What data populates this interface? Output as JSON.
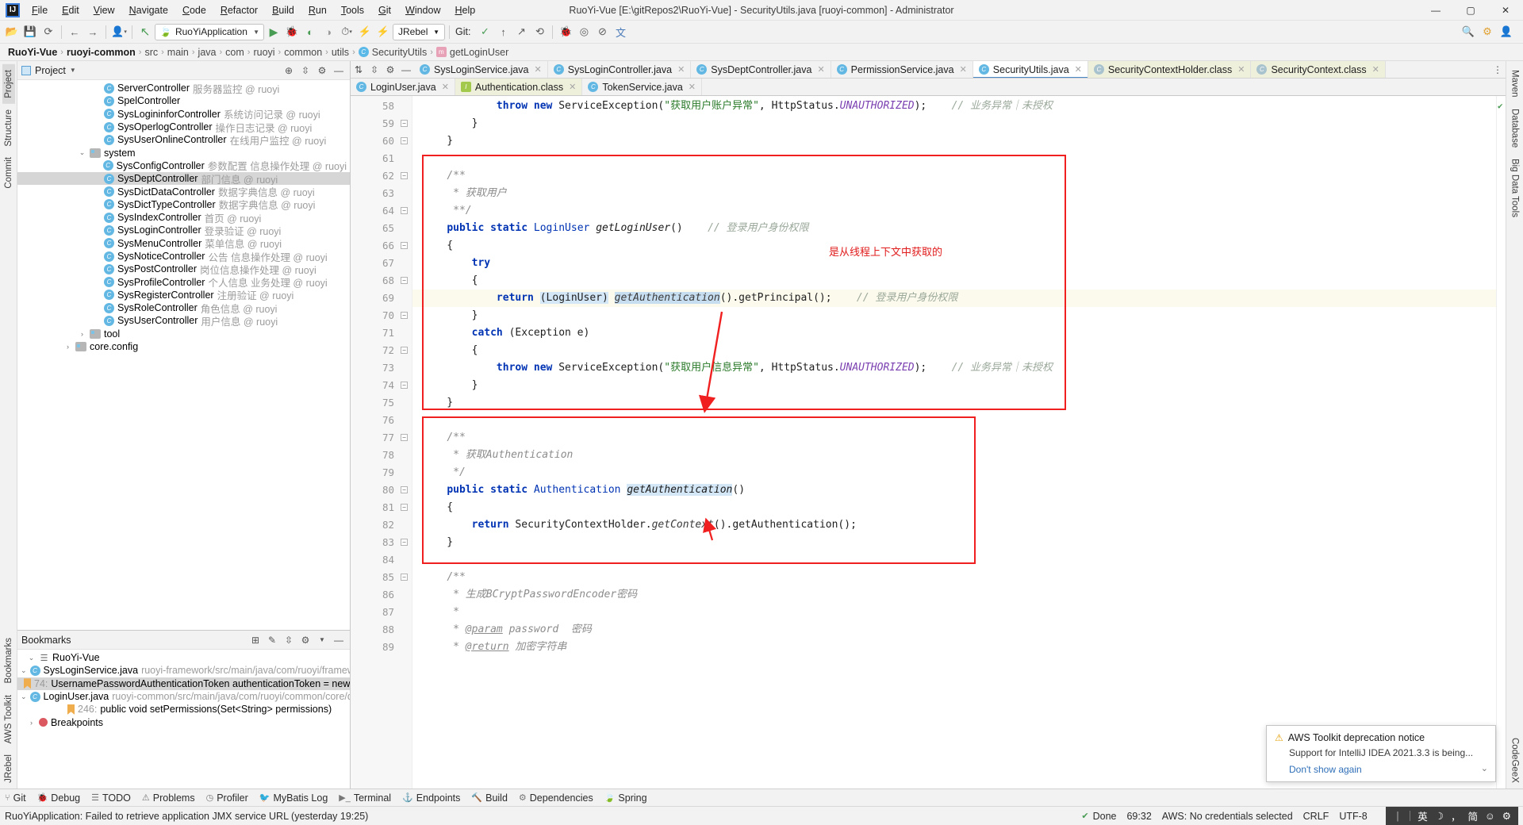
{
  "window": {
    "title": "RuoYi-Vue [E:\\gitRepos2\\RuoYi-Vue] - SecurityUtils.java [ruoyi-common] - Administrator",
    "minimize": "—",
    "maximize": "▢",
    "close": "✕"
  },
  "menu": [
    "File",
    "Edit",
    "View",
    "Navigate",
    "Code",
    "Refactor",
    "Build",
    "Run",
    "Tools",
    "Git",
    "Window",
    "Help"
  ],
  "toolbar": {
    "run_config": "RuoYiApplication",
    "jrebel": "JRebel",
    "git_label": "Git:",
    "icons": [
      "open-folder-icon",
      "save-icon",
      "sync-icon",
      "back-arrow-icon",
      "forward-arrow-icon",
      "user-icon",
      "update-project-icon"
    ],
    "run_icons": [
      "run-icon",
      "debug-icon",
      "run-coverage-icon",
      "profile-icon",
      "run-with-history-icon",
      "jrebel-run-icon",
      "jrebel-debug-icon"
    ],
    "git_icons": [
      "git-update-icon",
      "git-commit-icon",
      "git-push-icon",
      "git-history-icon",
      "git-rollback-icon"
    ],
    "right_icons": [
      "search-everywhere-icon",
      "settings-gear-icon",
      "account-icon"
    ]
  },
  "breadcrumb": [
    {
      "label": "RuoYi-Vue",
      "bold": true
    },
    {
      "label": "ruoyi-common",
      "bold": true
    },
    {
      "label": "src"
    },
    {
      "label": "main"
    },
    {
      "label": "java"
    },
    {
      "label": "com"
    },
    {
      "label": "ruoyi"
    },
    {
      "label": "common"
    },
    {
      "label": "utils"
    },
    {
      "label": "SecurityUtils",
      "icon": "class-icon"
    },
    {
      "label": "getLoginUser",
      "icon": "method-icon"
    }
  ],
  "left_rail": [
    "Project",
    "Structure",
    "Commit",
    "Bookmarks",
    "AWS Toolkit",
    "JRebel"
  ],
  "right_rail": [
    "Maven",
    "Database",
    "Big Data Tools",
    "CodeGeeX"
  ],
  "project_panel": {
    "title": "Project",
    "actions": [
      "target-icon",
      "collapse-all-icon",
      "settings-icon",
      "hide-icon"
    ],
    "tree": [
      {
        "indent": 5,
        "icon": "class",
        "name": "ServerController",
        "desc": "服务器监控 @ ruoyi"
      },
      {
        "indent": 5,
        "icon": "class",
        "name": "SpelController",
        "desc": ""
      },
      {
        "indent": 5,
        "icon": "class",
        "name": "SysLogininforController",
        "desc": "系统访问记录 @ ruoyi"
      },
      {
        "indent": 5,
        "icon": "class",
        "name": "SysOperlogController",
        "desc": "操作日志记录 @ ruoyi"
      },
      {
        "indent": 5,
        "icon": "class",
        "name": "SysUserOnlineController",
        "desc": "在线用户监控 @ ruoyi"
      },
      {
        "indent": 4,
        "icon": "folder",
        "arrow": "v",
        "name": "system",
        "desc": ""
      },
      {
        "indent": 5,
        "icon": "class",
        "name": "SysConfigController",
        "desc": "参数配置 信息操作处理 @ ruoyi"
      },
      {
        "indent": 5,
        "icon": "class",
        "name": "SysDeptController",
        "desc": "部门信息 @ ruoyi",
        "selected": true
      },
      {
        "indent": 5,
        "icon": "class",
        "name": "SysDictDataController",
        "desc": "数据字典信息 @ ruoyi"
      },
      {
        "indent": 5,
        "icon": "class",
        "name": "SysDictTypeController",
        "desc": "数据字典信息 @ ruoyi"
      },
      {
        "indent": 5,
        "icon": "class",
        "name": "SysIndexController",
        "desc": "首页 @ ruoyi"
      },
      {
        "indent": 5,
        "icon": "class",
        "name": "SysLoginController",
        "desc": "登录验证 @ ruoyi"
      },
      {
        "indent": 5,
        "icon": "class",
        "name": "SysMenuController",
        "desc": "菜单信息 @ ruoyi"
      },
      {
        "indent": 5,
        "icon": "class",
        "name": "SysNoticeController",
        "desc": "公告 信息操作处理 @ ruoyi"
      },
      {
        "indent": 5,
        "icon": "class",
        "name": "SysPostController",
        "desc": "岗位信息操作处理 @ ruoyi"
      },
      {
        "indent": 5,
        "icon": "class",
        "name": "SysProfileController",
        "desc": "个人信息 业务处理 @ ruoyi"
      },
      {
        "indent": 5,
        "icon": "class",
        "name": "SysRegisterController",
        "desc": "注册验证 @ ruoyi"
      },
      {
        "indent": 5,
        "icon": "class",
        "name": "SysRoleController",
        "desc": "角色信息 @ ruoyi"
      },
      {
        "indent": 5,
        "icon": "class",
        "name": "SysUserController",
        "desc": "用户信息 @ ruoyi"
      },
      {
        "indent": 4,
        "icon": "folder",
        "arrow": ">",
        "name": "tool",
        "desc": ""
      },
      {
        "indent": 3,
        "icon": "folder",
        "arrow": ">",
        "name": "core.config",
        "desc": ""
      }
    ]
  },
  "bookmarks_panel": {
    "title": "Bookmarks",
    "actions": [
      "add-list-icon",
      "edit-icon",
      "expand-icon",
      "settings-icon",
      "hide-icon"
    ],
    "items": [
      {
        "indent": 0,
        "arrow": "v",
        "icon": "list",
        "name": "RuoYi-Vue",
        "desc": ""
      },
      {
        "indent": 1,
        "arrow": "v",
        "icon": "class",
        "name": "SysLoginService.java",
        "desc": "ruoyi-framework/src/main/java/com/ruoyi/framewor"
      },
      {
        "indent": 2,
        "icon": "flag",
        "line": "74:",
        "name": "UsernamePasswordAuthenticationToken authenticationToken = new",
        "selected": true
      },
      {
        "indent": 1,
        "arrow": "v",
        "icon": "class",
        "name": "LoginUser.java",
        "desc": "ruoyi-common/src/main/java/com/ruoyi/common/core/do"
      },
      {
        "indent": 2,
        "icon": "flag",
        "line": "246:",
        "name": "public void setPermissions(Set<String> permissions)"
      },
      {
        "indent": 0,
        "arrow": ">",
        "icon": "breakpoint",
        "name": "Breakpoints",
        "desc": ""
      }
    ]
  },
  "editor_tabs_row1": [
    {
      "label": "SysLoginService.java",
      "icon": "class",
      "state": "normal"
    },
    {
      "label": "SysLoginController.java",
      "icon": "class",
      "state": "normal"
    },
    {
      "label": "SysDeptController.java",
      "icon": "class",
      "state": "normal"
    },
    {
      "label": "PermissionService.java",
      "icon": "class",
      "state": "normal"
    },
    {
      "label": "SecurityUtils.java",
      "icon": "class",
      "state": "active"
    },
    {
      "label": "SecurityContextHolder.class",
      "icon": "lock",
      "state": "class"
    },
    {
      "label": "SecurityContext.class",
      "icon": "lock",
      "state": "class"
    }
  ],
  "editor_tabs_row2": [
    {
      "label": "LoginUser.java",
      "icon": "class",
      "state": "normal"
    },
    {
      "label": "Authentication.class",
      "icon": "iface",
      "state": "class"
    },
    {
      "label": "TokenService.java",
      "icon": "class",
      "state": "normal"
    }
  ],
  "code": {
    "first_line": 58,
    "lines": [
      {
        "n": 58,
        "html": "            <span class='kw'>throw</span> <span class='kw'>new</span> ServiceException(<span class='str'>\"获取用户账户异常\"</span>, HttpStatus.<span class='stat'>UNAUTHORIZED</span>);    <span class='cmtg'>// 业务异常｜未授权</span>",
        "fold": false
      },
      {
        "n": 59,
        "html": "        }",
        "fold": true
      },
      {
        "n": 60,
        "html": "    }",
        "fold": true
      },
      {
        "n": 61,
        "html": "",
        "fold": false
      },
      {
        "n": 62,
        "html": "    <span class='cmt'>/**</span>",
        "fold": true
      },
      {
        "n": 63,
        "html": "     <span class='cmt'>* 获取用户</span>",
        "fold": false
      },
      {
        "n": 64,
        "html": "     <span class='cmt'>**/</span>",
        "fold": true
      },
      {
        "n": 65,
        "html": "    <span class='kw'>public</span> <span class='kw'>static</span> <span class='ty'>LoginUser</span> <span class='mthb'>getLoginUser</span>()    <span class='cmtg'>// 登录用户身份权限</span>",
        "fold": false
      },
      {
        "n": 66,
        "html": "    {",
        "fold": true
      },
      {
        "n": 67,
        "html": "        <span class='kw'>try</span>",
        "fold": false
      },
      {
        "n": 68,
        "html": "        {",
        "fold": true
      },
      {
        "n": 69,
        "html": "            <span class='kw'>return</span> <span class='hlsel'>(LoginUser)</span> <span class='mth hlsel2'>getAuthentication</span>().getPrincipal();    <span class='cmtg'>// 登录用户身份权限</span>",
        "fold": false,
        "hl": true
      },
      {
        "n": 70,
        "html": "        }",
        "fold": true
      },
      {
        "n": 71,
        "html": "        <span class='kw'>catch</span> (Exception e)",
        "fold": false
      },
      {
        "n": 72,
        "html": "        {",
        "fold": true
      },
      {
        "n": 73,
        "html": "            <span class='kw'>throw</span> <span class='kw'>new</span> ServiceException(<span class='str'>\"获取用户信息异常\"</span>, HttpStatus.<span class='stat'>UNAUTHORIZED</span>);    <span class='cmtg'>// 业务异常｜未授权</span>",
        "fold": false
      },
      {
        "n": 74,
        "html": "        }",
        "fold": true
      },
      {
        "n": 75,
        "html": "    }",
        "fold": false
      },
      {
        "n": 76,
        "html": "",
        "fold": false
      },
      {
        "n": 77,
        "html": "    <span class='cmt'>/**</span>",
        "fold": true
      },
      {
        "n": 78,
        "html": "     <span class='cmt'>* 获取Authentication</span>",
        "fold": false
      },
      {
        "n": 79,
        "html": "     <span class='cmt'>*/</span>",
        "fold": false
      },
      {
        "n": 80,
        "html": "    <span class='kw'>public</span> <span class='kw'>static</span> <span class='ty'>Authentication</span> <span class='mthb hlsel'>getAuthentication</span>()",
        "fold": true
      },
      {
        "n": 81,
        "html": "    {",
        "fold": true
      },
      {
        "n": 82,
        "html": "        <span class='kw'>return</span> SecurityContextHolder.<span class='mth'>getContext</span>().getAuthentication();",
        "fold": false
      },
      {
        "n": 83,
        "html": "    }",
        "fold": true
      },
      {
        "n": 84,
        "html": "",
        "fold": false
      },
      {
        "n": 85,
        "html": "    <span class='cmt'>/**</span>",
        "fold": true
      },
      {
        "n": 86,
        "html": "     <span class='cmt'>* 生成BCryptPasswordEncoder密码</span>",
        "fold": false
      },
      {
        "n": 87,
        "html": "     <span class='cmt'>*</span>",
        "fold": false
      },
      {
        "n": 88,
        "html": "     <span class='cmt'>* <u>@param</u> password  密码</span>",
        "fold": false
      },
      {
        "n": 89,
        "html": "     <span class='cmt'>* <u>@return</u> 加密字符串</span>",
        "fold": false
      }
    ]
  },
  "annotation": {
    "note_text": "是从线程上下文中获取的",
    "note_color": "#e01b1b",
    "box_color": "#f02020"
  },
  "notification": {
    "title": "AWS Toolkit deprecation notice",
    "warn_icon": "warning-icon",
    "message": "Support for IntelliJ IDEA 2021.3.3 is being...",
    "link": "Don't show again",
    "chevron": "chevron-down-icon"
  },
  "bottom_bar": [
    {
      "label": "Git",
      "icon": "git-icon"
    },
    {
      "label": "Debug",
      "icon": "debug-icon"
    },
    {
      "label": "TODO",
      "icon": "todo-icon"
    },
    {
      "label": "Problems",
      "icon": "problems-icon"
    },
    {
      "label": "Profiler",
      "icon": "profiler-icon"
    },
    {
      "label": "MyBatis Log",
      "icon": "mybatis-icon"
    },
    {
      "label": "Terminal",
      "icon": "terminal-icon"
    },
    {
      "label": "Endpoints",
      "icon": "endpoints-icon"
    },
    {
      "label": "Build",
      "icon": "build-icon"
    },
    {
      "label": "Dependencies",
      "icon": "dependencies-icon"
    },
    {
      "label": "Spring",
      "icon": "spring-icon"
    }
  ],
  "statusbar": {
    "message": "RuoYiApplication: Failed to retrieve application JMX service URL (yesterday 19:25)",
    "done": "Done",
    "caret": "69:32",
    "aws": "AWS: No credentials selected",
    "line_sep": "CRLF",
    "encoding": "UTF-8",
    "ime": {
      "bar": "｜",
      "lang": "英",
      "moon": "☽",
      "punct": "，",
      "simplified": "简",
      "smiley": "☺",
      "settings": "⚙"
    }
  }
}
